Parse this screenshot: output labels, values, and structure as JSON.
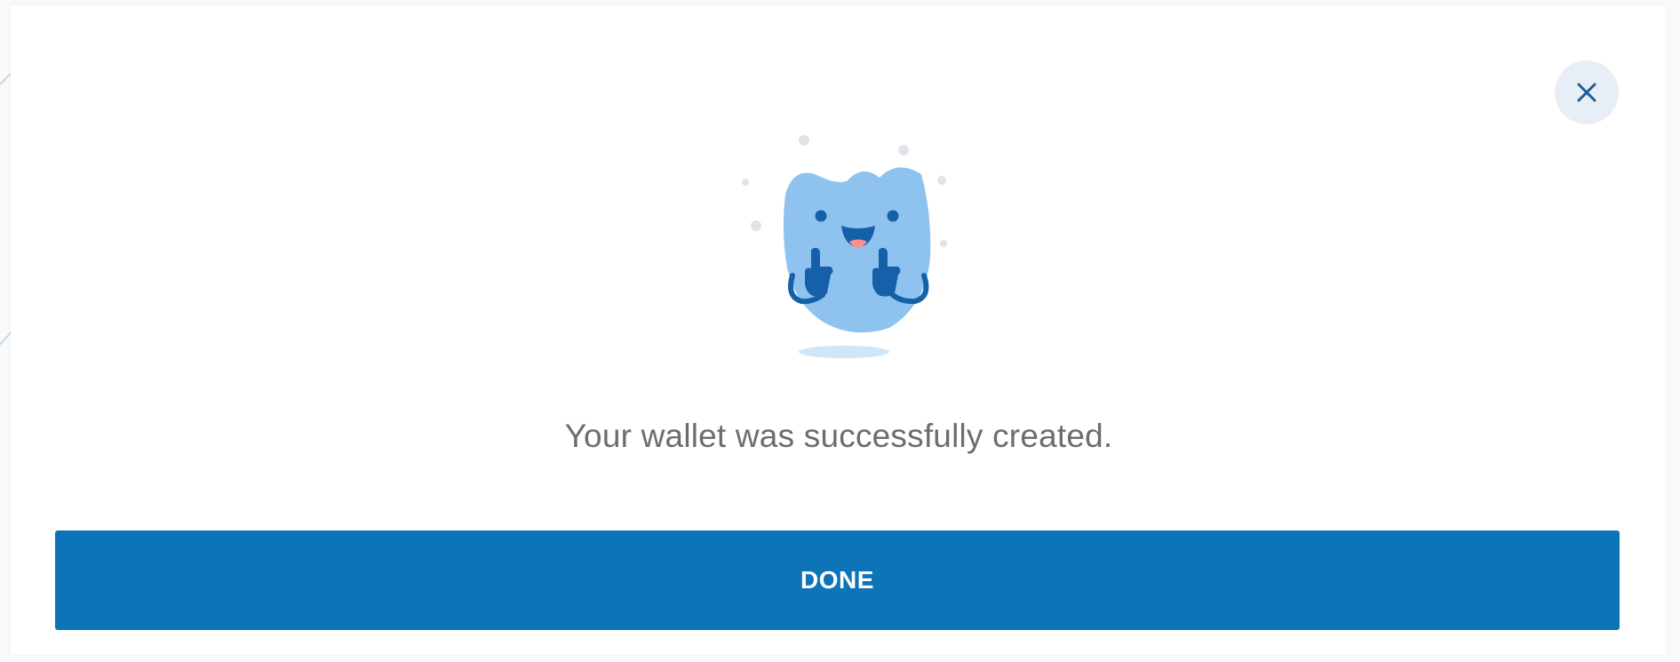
{
  "dialog": {
    "message": "Your wallet was successfully created.",
    "done_label": "DONE",
    "close_icon": "close-icon",
    "illustration_icon": "happy-wallet-mascot-icon"
  },
  "colors": {
    "accent": "#0d74b8",
    "close_button_bg": "#e8eef5",
    "mascot_body": "#8fc3ef",
    "mascot_dark": "#1560a8",
    "message_text": "#6d6d6d"
  }
}
